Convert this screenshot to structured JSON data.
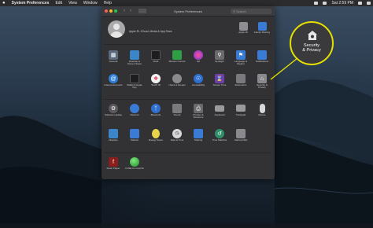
{
  "menubar": {
    "app_name": "System Preferences",
    "menus": [
      "Edit",
      "View",
      "Window",
      "Help"
    ],
    "clock": "Sat 2:59 PM"
  },
  "window": {
    "title": "System Preferences",
    "search_placeholder": "Search",
    "account_label": "Apple ID, iCloud, Media & App Store",
    "header_items": [
      {
        "label": "Apple ID",
        "icon": "apple-id-icon"
      },
      {
        "label": "Family Sharing",
        "icon": "family-sharing-icon"
      }
    ],
    "rows": [
      [
        {
          "label": "General",
          "icon": "general-icon",
          "color": "#5b6b7d"
        },
        {
          "label": "Desktop & Screen Saver",
          "icon": "desktop-icon",
          "color": "#3a86c8"
        },
        {
          "label": "Dock",
          "icon": "dock-icon",
          "color": "#1d1d1f"
        },
        {
          "label": "Mission Control",
          "icon": "mission-control-icon",
          "color": "#2f9e44"
        },
        {
          "label": "Siri",
          "icon": "siri-icon",
          "color": "#c13a8a"
        },
        {
          "label": "Spotlight",
          "icon": "spotlight-icon",
          "color": "#6a6a6e"
        },
        {
          "label": "Language & Region",
          "icon": "language-icon",
          "color": "#3a7bd5"
        },
        {
          "label": "Notifications",
          "icon": "notifications-icon",
          "color": "#3a7bd5"
        }
      ],
      [
        {
          "label": "Internet Accounts",
          "icon": "internet-accounts-icon",
          "color": "#2f7fd8"
        },
        {
          "label": "Wallet & Apple Pay",
          "icon": "wallet-icon",
          "color": "#1d1d1f"
        },
        {
          "label": "Touch ID",
          "icon": "touch-id-icon",
          "color": "#e8e8e8"
        },
        {
          "label": "Users & Groups",
          "icon": "users-icon",
          "color": "#8a8a8e"
        },
        {
          "label": "Accessibility",
          "icon": "accessibility-icon",
          "color": "#2f6fd0"
        },
        {
          "label": "Screen Time",
          "icon": "screen-time-icon",
          "color": "#6b3fb0"
        },
        {
          "label": "Extensions",
          "icon": "extensions-icon",
          "color": "#7a7a7e"
        },
        {
          "label": "Security & Privacy",
          "icon": "security-privacy-icon",
          "color": "#8a8a8e"
        }
      ],
      [
        {
          "label": "Software Update",
          "icon": "software-update-icon",
          "color": "#5a5a5e"
        },
        {
          "label": "Network",
          "icon": "network-icon",
          "color": "#3a7bd5"
        },
        {
          "label": "Bluetooth",
          "icon": "bluetooth-icon",
          "color": "#2f6fd0"
        },
        {
          "label": "Sound",
          "icon": "sound-icon",
          "color": "#7a7a7e"
        },
        {
          "label": "Printers & Scanners",
          "icon": "printers-icon",
          "color": "#6a6a6e"
        },
        {
          "label": "Keyboard",
          "icon": "keyboard-icon",
          "color": "#9a9a9e"
        },
        {
          "label": "Trackpad",
          "icon": "trackpad-icon",
          "color": "#9a9a9e"
        },
        {
          "label": "Mouse",
          "icon": "mouse-icon",
          "color": "#d8d8d8"
        }
      ],
      [
        {
          "label": "Displays",
          "icon": "displays-icon",
          "color": "#3a86c8"
        },
        {
          "label": "Sidecar",
          "icon": "sidecar-icon",
          "color": "#3a7bd5"
        },
        {
          "label": "Energy Saver",
          "icon": "energy-saver-icon",
          "color": "#e8d44a"
        },
        {
          "label": "Date & Time",
          "icon": "date-time-icon",
          "color": "#d8d8d8"
        },
        {
          "label": "Sharing",
          "icon": "sharing-icon",
          "color": "#3a7bd5"
        },
        {
          "label": "Time Machine",
          "icon": "time-machine-icon",
          "color": "#2f8f6a"
        },
        {
          "label": "Startup Disk",
          "icon": "startup-disk-icon",
          "color": "#8a8a8e"
        }
      ],
      [
        {
          "label": "Flash Player",
          "icon": "flash-player-icon",
          "color": "#8a1d1d"
        },
        {
          "label": "FUSE for macOS",
          "icon": "fuse-icon",
          "color": "#2fae3a"
        }
      ]
    ]
  },
  "callout": {
    "label_line1": "Security",
    "label_line2": "& Privacy",
    "color": "#e6e000"
  }
}
